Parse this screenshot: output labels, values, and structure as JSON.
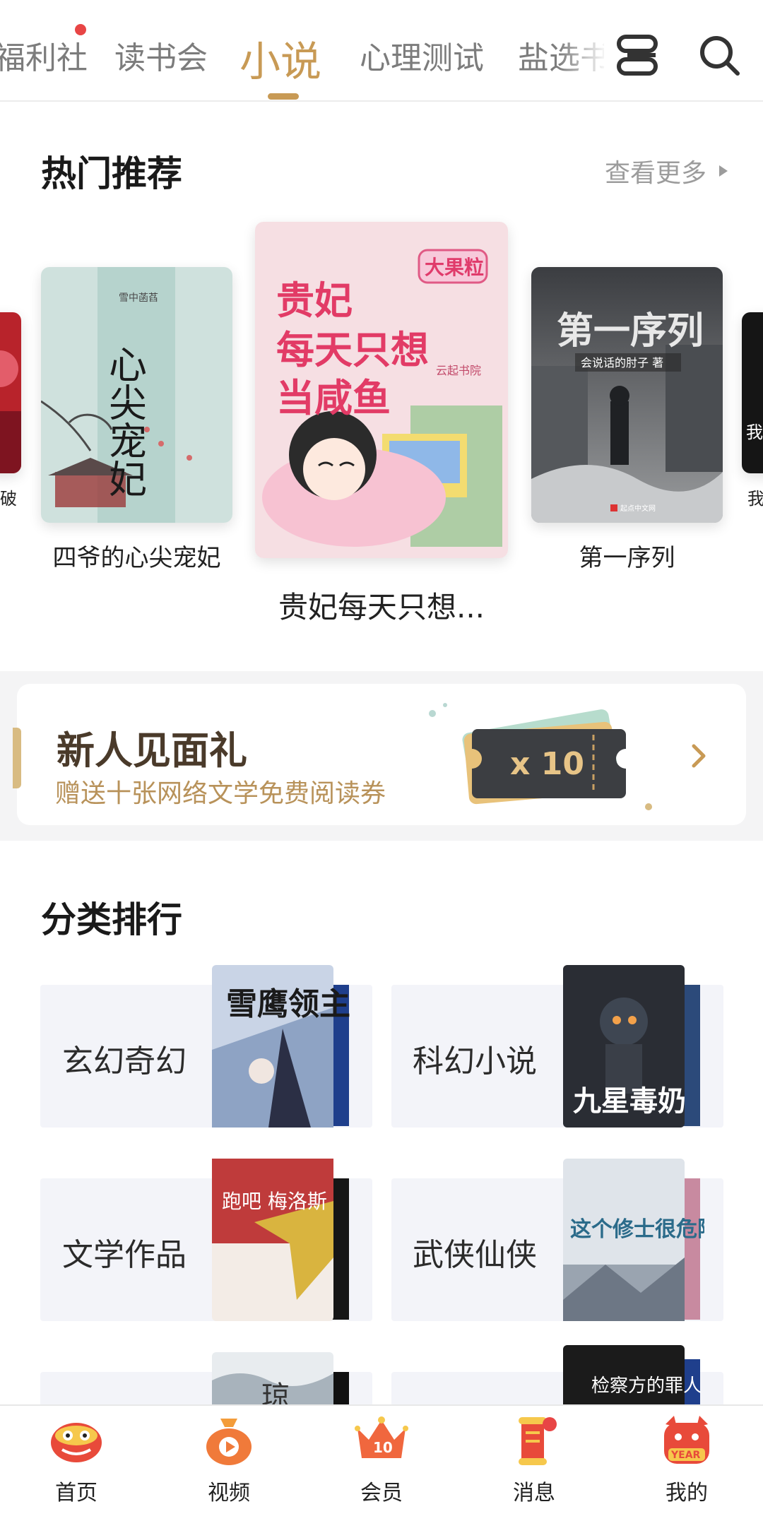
{
  "top_tabs": [
    {
      "label": "福利社",
      "active": false
    },
    {
      "label": "读书会",
      "active": false
    },
    {
      "label": "小说",
      "active": true
    },
    {
      "label": "心理测试",
      "active": false
    },
    {
      "label": "盐选书",
      "active": false
    }
  ],
  "top_icons": [
    "layers-icon",
    "search-icon"
  ],
  "hot": {
    "title": "热门推荐",
    "more": "查看更多",
    "books": [
      {
        "title": "破",
        "cover_text": ""
      },
      {
        "title": "四爷的心尖宠妃",
        "cover_text": "心尖宠妃",
        "cover_author": "雪中菡萏"
      },
      {
        "title": "贵妃每天只想...",
        "cover_text": "贵妃每天只想当咸鱼",
        "cover_author": "大果粒",
        "cover_publisher": "云起书院"
      },
      {
        "title": "第一序列",
        "cover_text": "第一序列",
        "cover_author": "会说话的肘子 著",
        "cover_publisher": "起点中文网"
      },
      {
        "title": "我",
        "cover_text": "我"
      }
    ]
  },
  "gift": {
    "title": "新人见面礼",
    "subtitle": "赠送十张网络文学免费阅读券",
    "ticket": "x 10"
  },
  "ranking": {
    "title": "分类排行",
    "categories": [
      {
        "label": "玄幻奇幻",
        "cover_text": "雪鹰领主"
      },
      {
        "label": "科幻小说",
        "cover_text": "九星毒奶"
      },
      {
        "label": "文学作品",
        "cover_text": "跑吧 梅洛斯"
      },
      {
        "label": "武侠仙侠",
        "cover_text": "这个修士很危险"
      },
      {
        "label": "",
        "cover_text": "琼"
      },
      {
        "label": "",
        "cover_text": "检察方的罪人"
      }
    ]
  },
  "bottom_nav": [
    {
      "label": "首页",
      "icon": "lion-dance-icon"
    },
    {
      "label": "视频",
      "icon": "money-bag-play-icon"
    },
    {
      "label": "会员",
      "icon": "crown-icon",
      "badge_text": "10"
    },
    {
      "label": "消息",
      "icon": "scroll-message-icon"
    },
    {
      "label": "我的",
      "icon": "year-mascot-icon",
      "badge_text": "YEAR"
    }
  ],
  "colors": {
    "accent": "#c89a55",
    "badge": "#e84545",
    "card_bg": "#f3f4f9"
  }
}
